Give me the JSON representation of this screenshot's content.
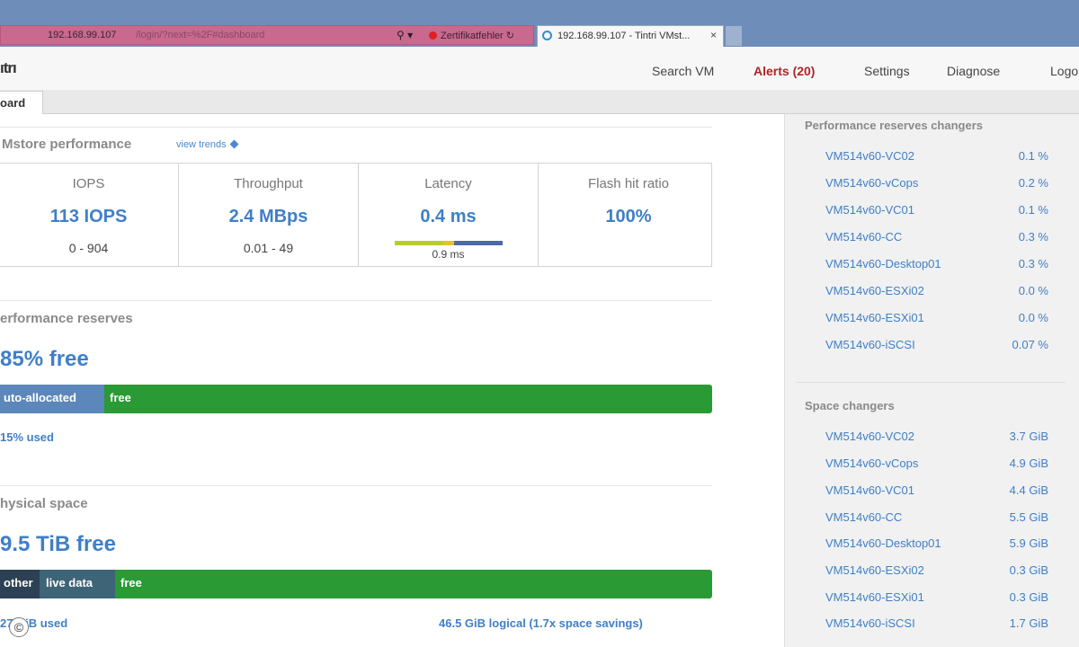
{
  "browser": {
    "address_url": "192.168.99.107",
    "address_faded": "/login/?next=%2F#dashboard",
    "address_controls": "⚲ ▾",
    "cert_error": "Zertifikatfehler",
    "refresh": "↻",
    "tab_title": "192.168.99.107 - Tintri VMst...",
    "tab_close": "×"
  },
  "header": {
    "logo": "ıtrı",
    "nav": {
      "search_vm": "Search VM",
      "alerts": "Alerts (20)",
      "settings": "Settings",
      "diagnose": "Diagnose",
      "logout": "Logo"
    }
  },
  "tabs": {
    "dashboard": "oard"
  },
  "performance": {
    "title": "Mstore performance",
    "view_trends": "view trends",
    "metrics": [
      {
        "label": "IOPS",
        "value": "113 IOPS",
        "range": "0 - 904"
      },
      {
        "label": "Throughput",
        "value": "2.4 MBps",
        "range": "0.01 - 49"
      },
      {
        "label": "Latency",
        "value": "0.4 ms",
        "range": "0.9 ms"
      },
      {
        "label": "Flash hit ratio",
        "value": "100%",
        "range": ""
      }
    ]
  },
  "reserves": {
    "title": "erformance reserves",
    "free": "85% free",
    "bar_auto": "uto-allocated",
    "bar_free": "free",
    "used": "15% used"
  },
  "physical": {
    "title": "hysical space",
    "free": "9.5 TiB free",
    "bar_other": "other",
    "bar_live": "live data",
    "bar_free": "free",
    "used": "27 GiB used",
    "logical": "46.5 GiB logical (1.7x space savings)"
  },
  "sidebar": {
    "perf_title": "Performance reserves changers",
    "perf_rows": [
      {
        "name": "VM514v60-VC02",
        "value": "0.1 %"
      },
      {
        "name": "VM514v60-vCops",
        "value": "0.2 %"
      },
      {
        "name": "VM514v60-VC01",
        "value": "0.1 %"
      },
      {
        "name": "VM514v60-CC",
        "value": "0.3 %"
      },
      {
        "name": "VM514v60-Desktop01",
        "value": "0.3 %"
      },
      {
        "name": "VM514v60-ESXi02",
        "value": "0.0 %"
      },
      {
        "name": "VM514v60-ESXi01",
        "value": "0.0 %"
      },
      {
        "name": "VM514v60-iSCSI",
        "value": "0.07 %"
      }
    ],
    "space_title": "Space changers",
    "space_rows": [
      {
        "name": "VM514v60-VC02",
        "value": "3.7 GiB"
      },
      {
        "name": "VM514v60-vCops",
        "value": "4.9 GiB"
      },
      {
        "name": "VM514v60-VC01",
        "value": "4.4 GiB"
      },
      {
        "name": "VM514v60-CC",
        "value": "5.5 GiB"
      },
      {
        "name": "VM514v60-Desktop01",
        "value": "5.9 GiB"
      },
      {
        "name": "VM514v60-ESXi02",
        "value": "0.3 GiB"
      },
      {
        "name": "VM514v60-ESXi01",
        "value": "0.3 GiB"
      },
      {
        "name": "VM514v60-iSCSI",
        "value": "1.7 GiB"
      }
    ]
  },
  "copyright": "©"
}
